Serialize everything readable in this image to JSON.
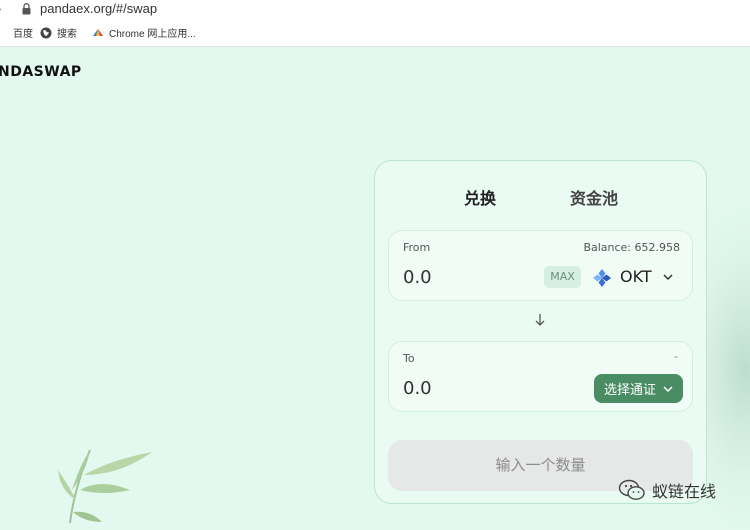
{
  "browser": {
    "url": "pandaex.org/#/swap",
    "bookmarks": [
      {
        "label": "百度",
        "icon": "paw-icon"
      },
      {
        "label": "搜索",
        "icon": "globe-icon"
      },
      {
        "label": "Chrome 网上应用...",
        "icon": "chrome-icon"
      }
    ]
  },
  "logo": {
    "text": "NDASWAP"
  },
  "swap": {
    "tabs": [
      "兑换",
      "资金池"
    ],
    "from": {
      "label": "From",
      "balance": "Balance: 652.958",
      "amount": "0.0",
      "max_label": "MAX",
      "token": "OKT"
    },
    "to": {
      "label": "To",
      "balance": "-",
      "amount": "0.0",
      "select_label": "选择通证"
    },
    "submit_label": "输入一个数量"
  },
  "watermark": {
    "text": "蚁链在线"
  },
  "colors": {
    "background": "#e3f9ef",
    "accent": "#4a8d64"
  }
}
